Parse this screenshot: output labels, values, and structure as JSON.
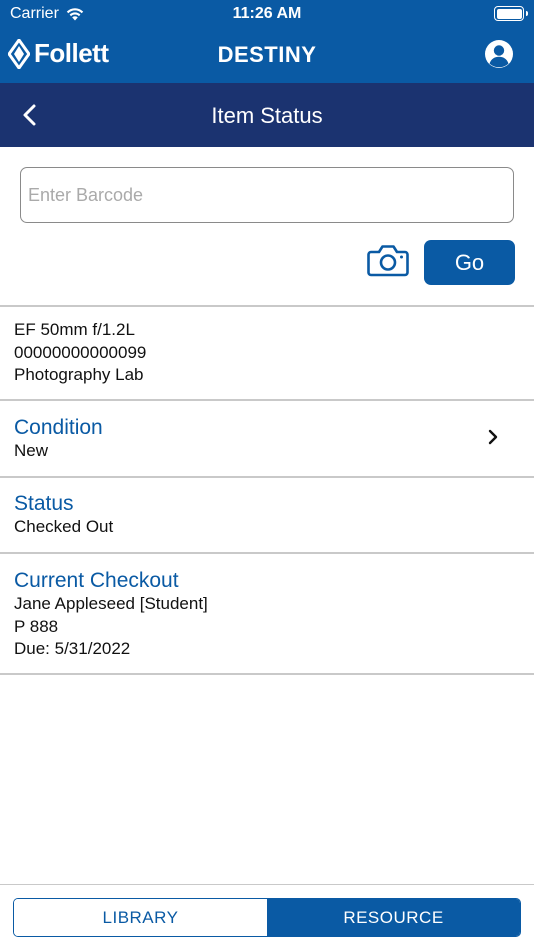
{
  "status_bar": {
    "carrier": "Carrier",
    "time": "11:26 AM"
  },
  "header": {
    "brand": "Follett",
    "title": "DESTINY"
  },
  "nav": {
    "title": "Item Status"
  },
  "search": {
    "placeholder": "Enter Barcode",
    "value": "",
    "go_label": "Go"
  },
  "item": {
    "name": "EF 50mm f/1.2L",
    "barcode": "00000000000099",
    "location": "Photography Lab"
  },
  "condition": {
    "label": "Condition",
    "value": "New"
  },
  "status": {
    "label": "Status",
    "value": "Checked Out"
  },
  "checkout": {
    "label": "Current Checkout",
    "patron": "Jane Appleseed [Student]",
    "id": "P 888",
    "due": "Due: 5/31/2022"
  },
  "tabs": [
    {
      "label": "LIBRARY",
      "active": false
    },
    {
      "label": "RESOURCE",
      "active": true
    }
  ],
  "colors": {
    "brand_blue": "#0a5aa4",
    "nav_navy": "#1b3370",
    "divider": "#c9c9c9"
  },
  "icons": [
    "wifi-icon",
    "battery-icon",
    "follett-logo-icon",
    "user-account-icon",
    "back-chevron-icon",
    "camera-icon",
    "chevron-right-icon"
  ]
}
